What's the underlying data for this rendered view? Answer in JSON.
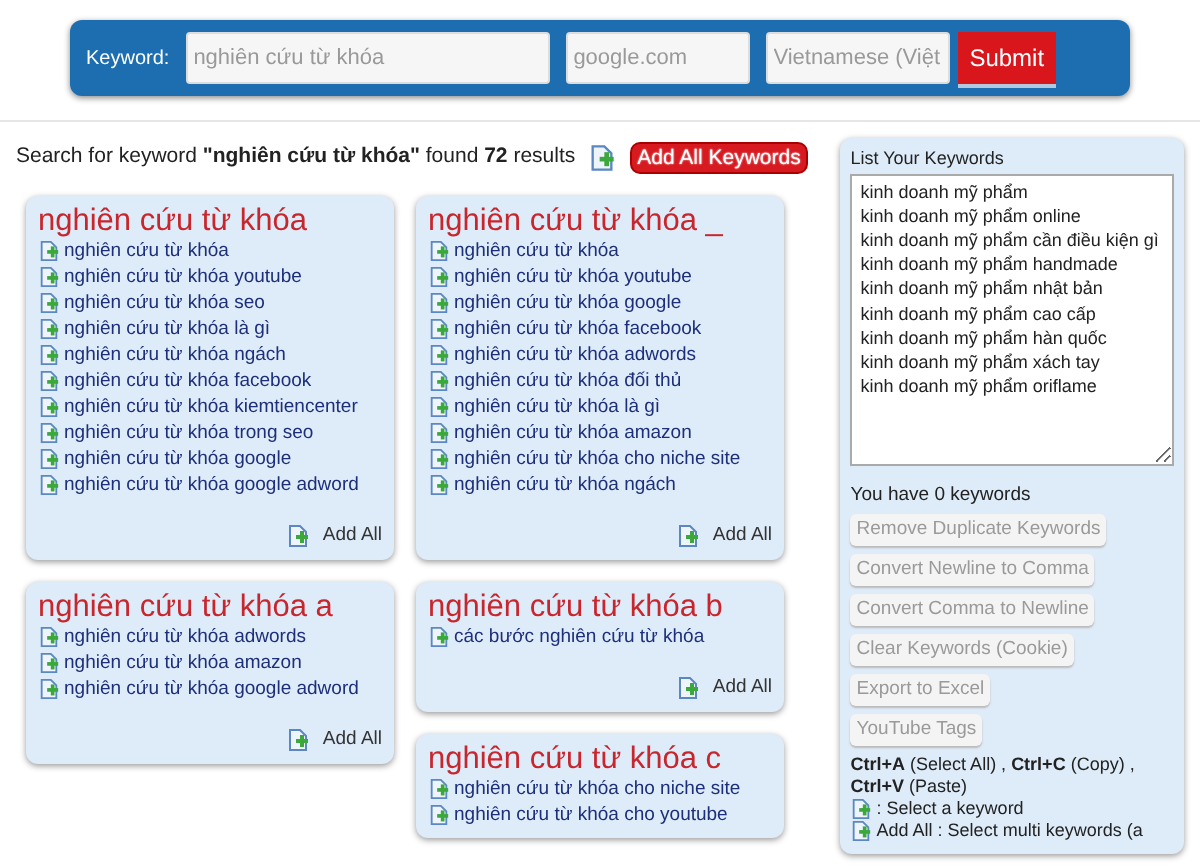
{
  "search_bar": {
    "label": "Keyword:",
    "keyword_placeholder": "nghiên cứu từ khóa",
    "site_placeholder": "google.com",
    "language_placeholder": "Vietnamese (Việt",
    "submit": "Submit"
  },
  "summary": {
    "text": "Search for keyword **\"nghiên cứu từ khóa\"** found **72** results",
    "add_all_keywords": "Add All Keywords"
  },
  "columns": [
    [
      {
        "title": "nghiên cứu từ khóa",
        "keywords": [
          "nghiên cứu từ khóa",
          "nghiên cứu từ khóa youtube",
          "nghiên cứu từ khóa seo",
          "nghiên cứu từ khóa là gì",
          "nghiên cứu từ khóa ngách",
          "nghiên cứu từ khóa facebook",
          "nghiên cứu từ khóa kiemtiencenter",
          "nghiên cứu từ khóa trong seo",
          "nghiên cứu từ khóa google",
          "nghiên cứu từ khóa google adword"
        ],
        "add_all": "Add All"
      },
      {
        "title": "nghiên cứu từ khóa a",
        "keywords": [
          "nghiên cứu từ khóa adwords",
          "nghiên cứu từ khóa amazon",
          "nghiên cứu từ khóa google adword"
        ],
        "add_all": "Add All"
      }
    ],
    [
      {
        "title": "nghiên cứu từ khóa _",
        "keywords": [
          "nghiên cứu từ khóa",
          "nghiên cứu từ khóa youtube",
          "nghiên cứu từ khóa google",
          "nghiên cứu từ khóa facebook",
          "nghiên cứu từ khóa adwords",
          "nghiên cứu từ khóa đối thủ",
          "nghiên cứu từ khóa là gì",
          "nghiên cứu từ khóa amazon",
          "nghiên cứu từ khóa cho niche site",
          "nghiên cứu từ khóa ngách"
        ],
        "add_all": "Add All"
      },
      {
        "title": "nghiên cứu từ khóa b",
        "keywords": [
          "các bước nghiên cứu từ khóa"
        ],
        "add_all": "Add All"
      },
      {
        "title": "nghiên cứu từ khóa c",
        "keywords": [
          "nghiên cứu từ khóa cho niche site",
          "nghiên cứu từ khóa cho youtube"
        ]
      }
    ]
  ],
  "keyword_panel": {
    "title": "List Your Keywords",
    "keywords": [
      "kinh doanh mỹ phẩm",
      "kinh doanh mỹ phẩm online",
      "kinh doanh mỹ phẩm cần điều kiện gì",
      "kinh doanh mỹ phẩm handmade",
      "kinh doanh mỹ phẩm nhật bản",
      "kinh doanh mỹ phẩm cao cấp",
      "kinh doanh mỹ phẩm hàn quốc",
      "kinh doanh mỹ phẩm xách tay",
      "kinh doanh mỹ phẩm oriflame"
    ],
    "count": "You have 0 keywords",
    "buttons": [
      "Remove Duplicate Keywords",
      "Convert Newline to Comma",
      "Convert Comma to Newline",
      "Clear Keywords (Cookie)",
      "Export to Excel",
      "YouTube Tags"
    ],
    "shortcuts": "**Ctrl+A** (Select All) , **Ctrl+C** (Copy) , **Ctrl+V** (Paste)",
    "legend": [
      ": Select a keyword",
      "Add All : Select multi keywords (a"
    ]
  }
}
